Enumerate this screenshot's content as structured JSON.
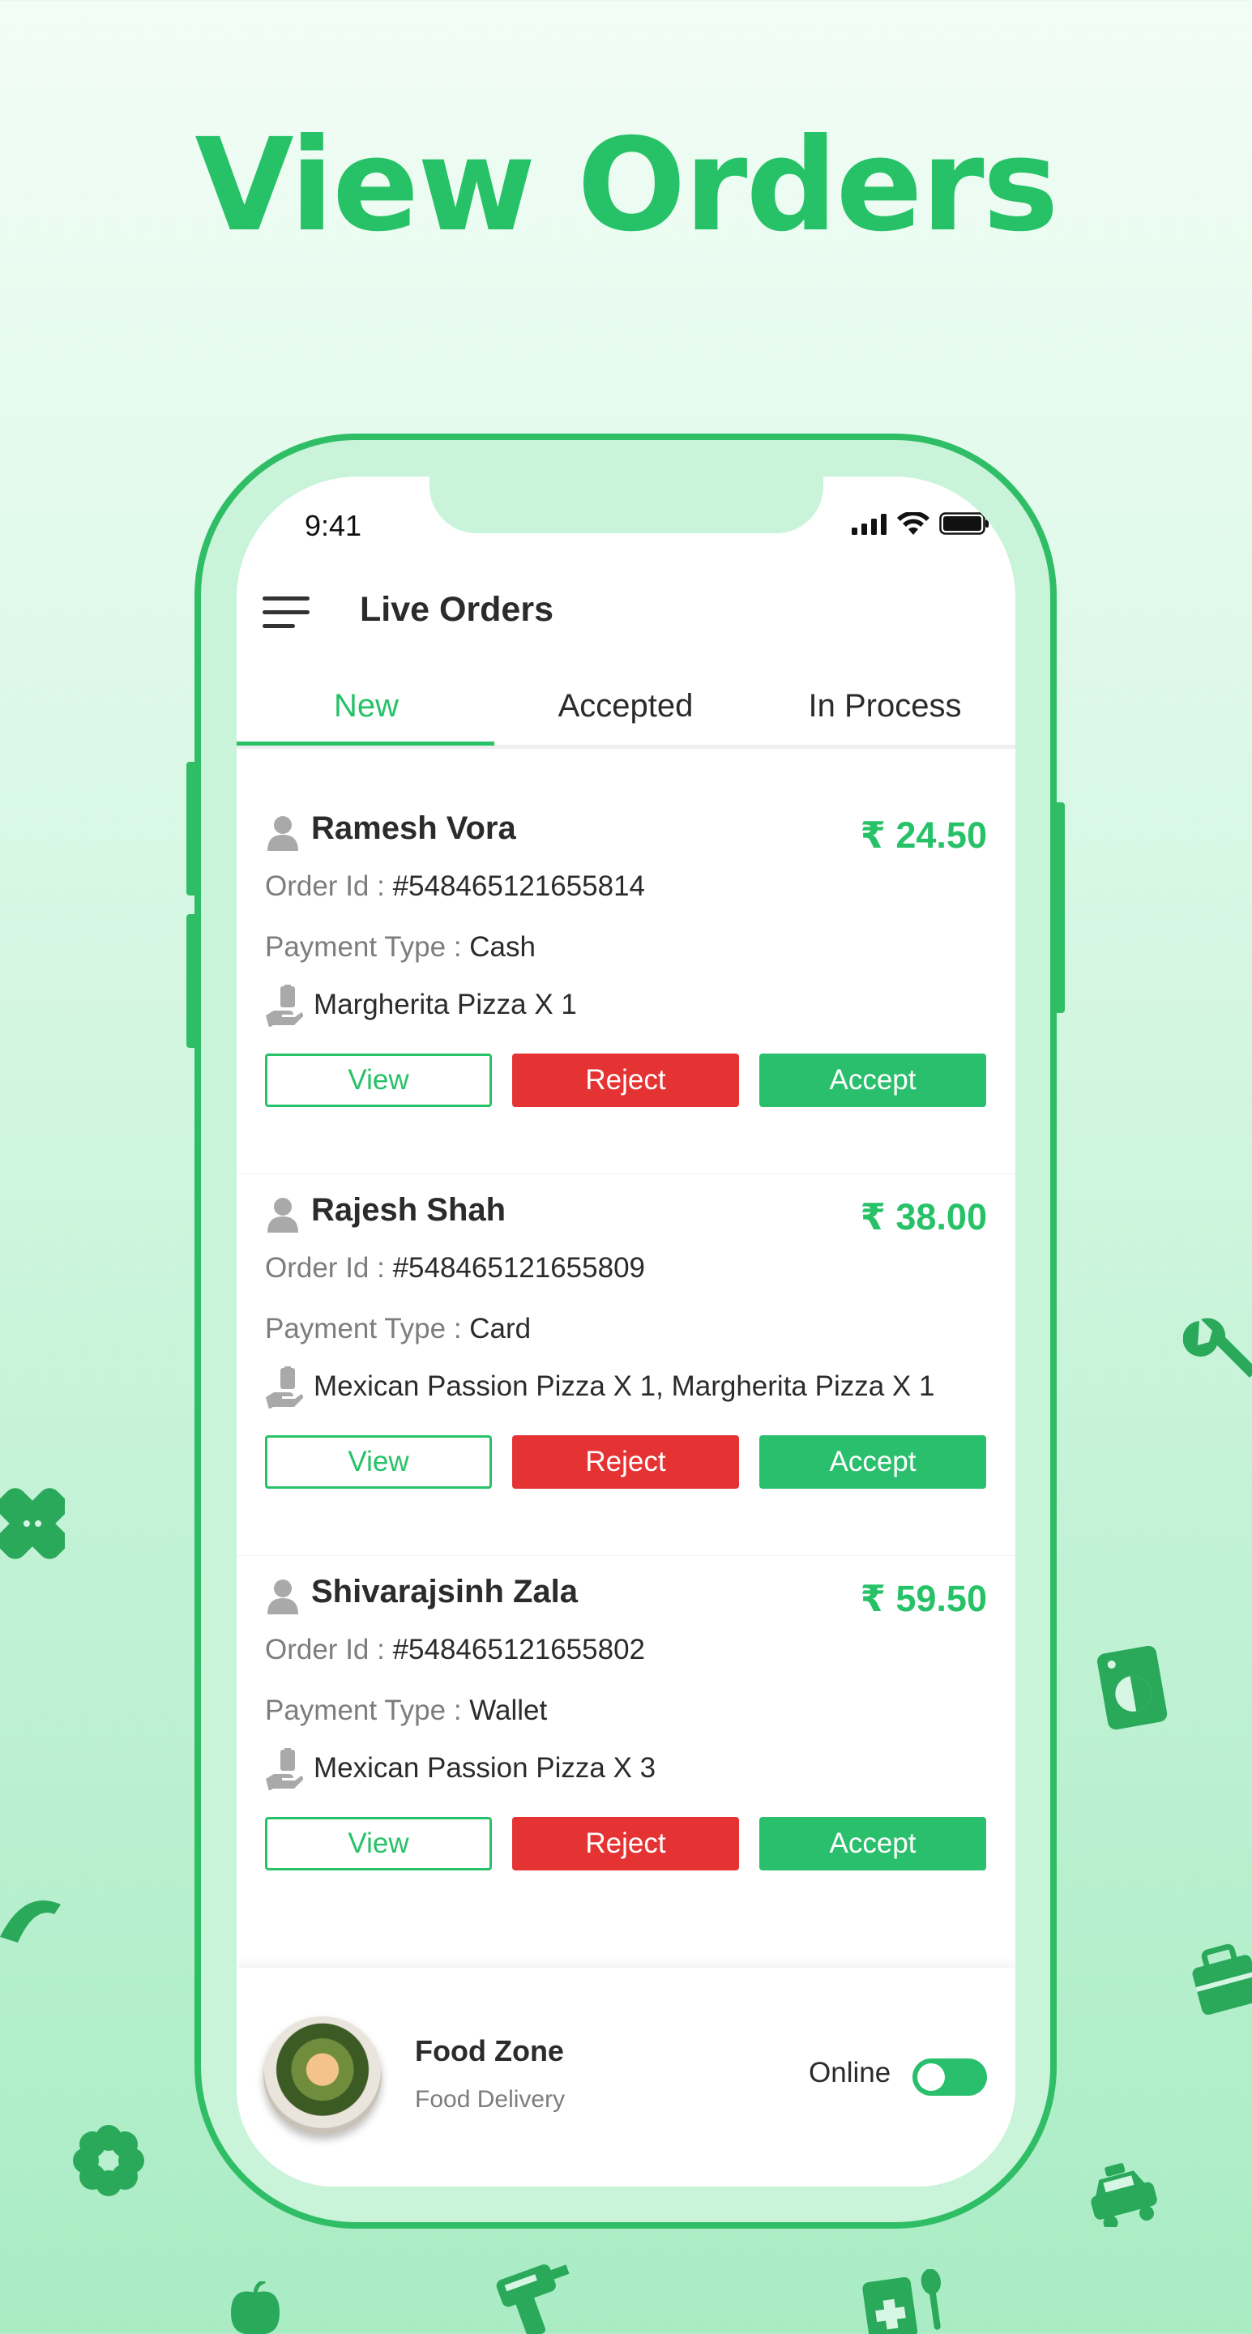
{
  "headline": "View Orders",
  "status_bar": {
    "time": "9:41"
  },
  "app_bar": {
    "title": "Live Orders"
  },
  "tabs": [
    {
      "label": "New",
      "active": true
    },
    {
      "label": "Accepted",
      "active": false
    },
    {
      "label": "In Process",
      "active": false
    }
  ],
  "labels": {
    "order_id": "Order Id :",
    "payment_type": "Payment Type :"
  },
  "orders": [
    {
      "customer": "Ramesh Vora",
      "price": "₹ 24.50",
      "order_id": "#548465121655814",
      "payment": "Cash",
      "items": "Margherita Pizza X 1"
    },
    {
      "customer": "Rajesh Shah",
      "price": "₹ 38.00",
      "order_id": "#548465121655809",
      "payment": "Card",
      "items": "Mexican Passion Pizza X 1, Margherita Pizza X 1"
    },
    {
      "customer": "Shivarajsinh Zala",
      "price": "₹ 59.50",
      "order_id": "#548465121655802",
      "payment": "Wallet",
      "items": "Mexican Passion Pizza X 3"
    }
  ],
  "buttons": {
    "view": "View",
    "reject": "Reject",
    "accept": "Accept"
  },
  "store": {
    "name": "Food Zone",
    "subtitle": "Food Delivery",
    "status_label": "Online",
    "online": true
  },
  "colors": {
    "accent": "#27c268",
    "reject": "#e53232",
    "accept": "#2abf6c"
  },
  "icons": [
    "menu-icon",
    "person-icon",
    "delivery-hand-icon",
    "signal-icon",
    "wifi-icon",
    "battery-icon",
    "wrench-icon",
    "bandage-icon",
    "washing-machine-icon",
    "croissant-icon",
    "toolbox-icon",
    "gear-flower-icon",
    "taxi-icon",
    "apple-icon",
    "drill-icon",
    "medicine-icon"
  ]
}
